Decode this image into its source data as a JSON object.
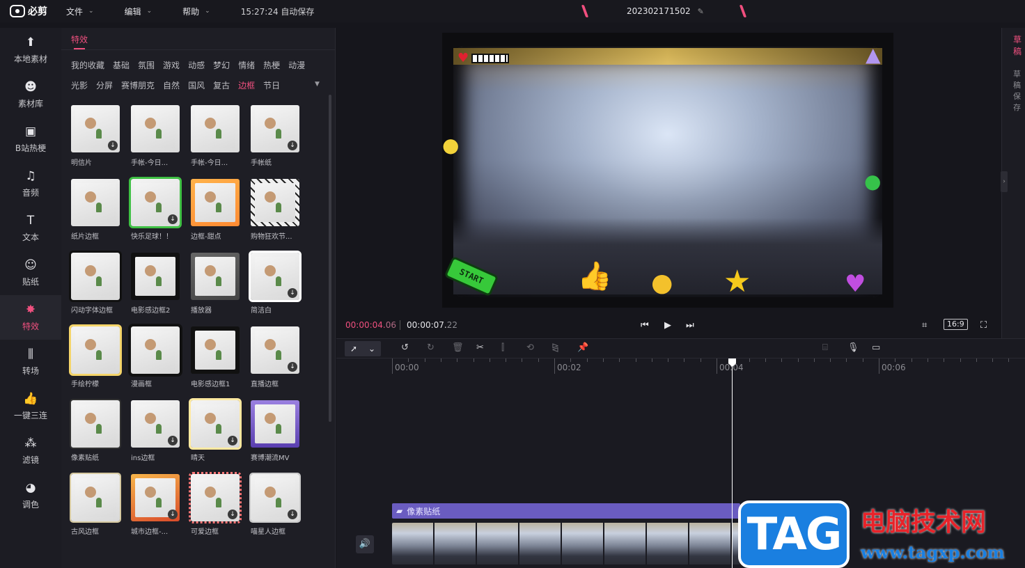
{
  "topbar": {
    "app_name": "必剪",
    "menus": [
      {
        "label": "文件"
      },
      {
        "label": "编辑"
      },
      {
        "label": "帮助"
      }
    ],
    "autosave": "15:27:24 自动保存",
    "project_name": "202302171502"
  },
  "sidebar": {
    "items": [
      {
        "label": "本地素材",
        "icon": "upload-icon"
      },
      {
        "label": "素材库",
        "icon": "library-icon"
      },
      {
        "label": "B站热梗",
        "icon": "tv-icon"
      },
      {
        "label": "音频",
        "icon": "music-icon"
      },
      {
        "label": "文本",
        "icon": "text-icon"
      },
      {
        "label": "贴纸",
        "icon": "sticker-icon"
      },
      {
        "label": "特效",
        "icon": "star-icon",
        "active": true
      },
      {
        "label": "转场",
        "icon": "transition-icon"
      },
      {
        "label": "一键三连",
        "icon": "thumbs-up-icon"
      },
      {
        "label": "滤镜",
        "icon": "filter-icon"
      },
      {
        "label": "调色",
        "icon": "palette-icon"
      }
    ]
  },
  "effects": {
    "tab": "特效",
    "categories_row1": [
      "我的收藏",
      "基础",
      "氛围",
      "游戏",
      "动感",
      "梦幻",
      "情绪",
      "热梗",
      "动漫"
    ],
    "categories_row2": [
      "光影",
      "分屏",
      "赛博朋克",
      "自然",
      "国风",
      "复古",
      "边框",
      "节日"
    ],
    "active_category": "边框",
    "cards": [
      [
        "明信片",
        "手帐-今日...",
        "手帐-今日...",
        "手帐纸"
      ],
      [
        "纸片边框",
        "快乐足球！！",
        "边框-甜点",
        "购物狂欢节..."
      ],
      [
        "闪动字体边框",
        "电影感边框2",
        "播放器",
        "简洁白"
      ],
      [
        "手绘柠檬",
        "漫画框",
        "电影感边框1",
        "直播边框"
      ],
      [
        "像素贴纸",
        "ins边框",
        "晴天",
        "赛博潮流MV"
      ],
      [
        "古风边框",
        "城市边框-...",
        "可爱边框",
        "喵星人边框"
      ]
    ]
  },
  "preview": {
    "sticker_text": "START",
    "time_current": "00:00:04.",
    "time_current_ms": "06",
    "time_total": "00:00:07.",
    "time_total_ms": "22",
    "ratio": "16:9"
  },
  "right_panel": {
    "tab": "草稿",
    "item1": "草稿",
    "item2": "保存"
  },
  "timeline": {
    "ruler_labels": [
      "00:00",
      "00:02",
      "00:04",
      "00:06"
    ],
    "fx_clip_label": "像素贴纸"
  },
  "watermark": {
    "tag": "TAG",
    "cn": "电脑技术网",
    "url": "www.tagxp.com"
  },
  "colors": {
    "accent": "#f0507f",
    "fx_track": "#6a5cc0"
  }
}
